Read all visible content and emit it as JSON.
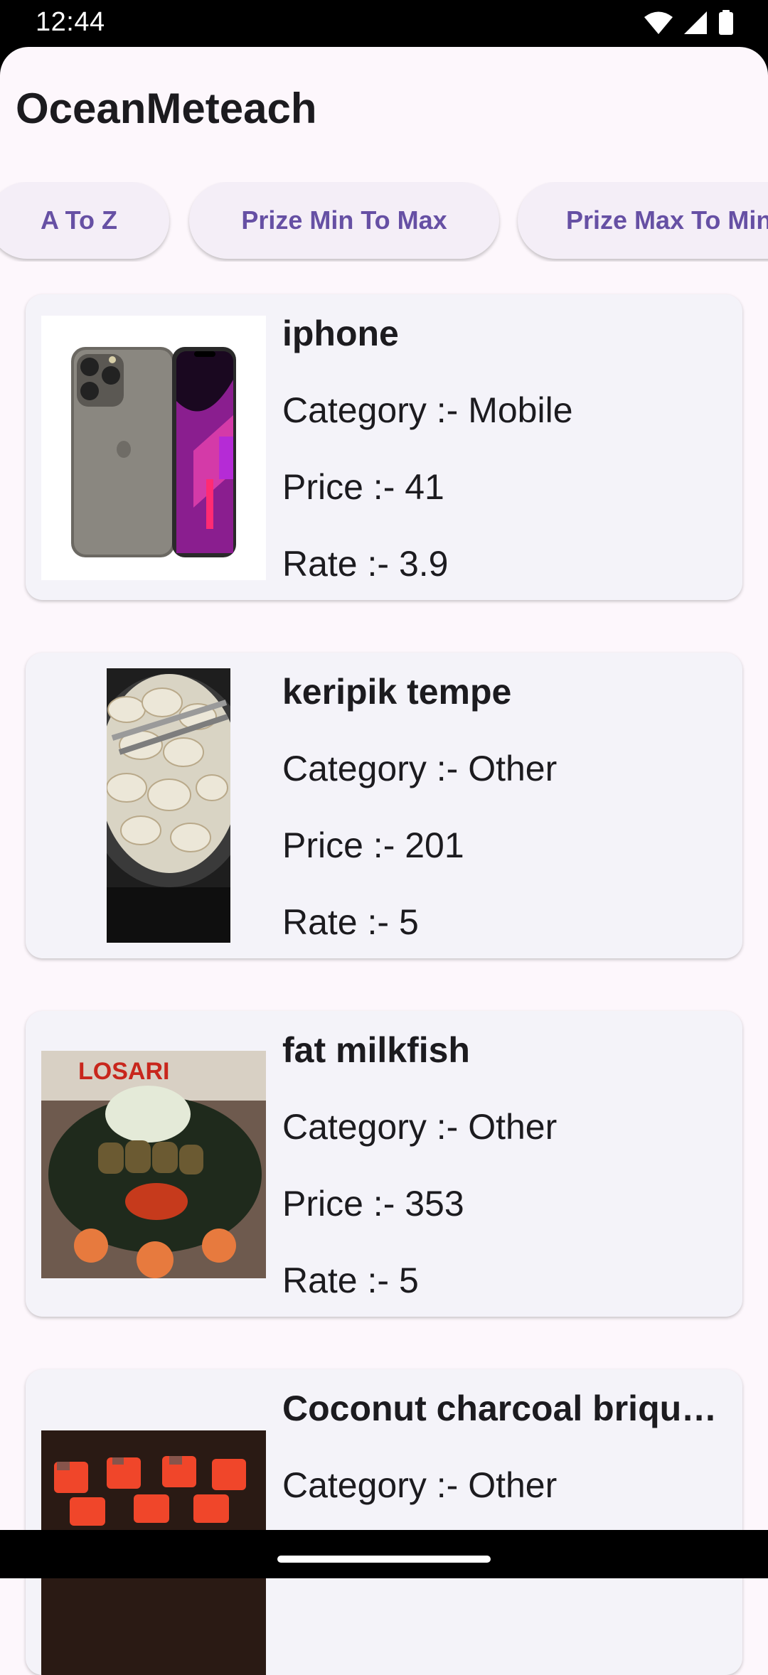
{
  "status_bar": {
    "time": "12:44"
  },
  "app": {
    "title": "OceanMeteach"
  },
  "sort_chips": [
    {
      "label": "A To Z"
    },
    {
      "label": "Prize Min To Max"
    },
    {
      "label": "Prize Max To Min"
    }
  ],
  "products": [
    {
      "name": "iphone",
      "category": "Category :- Mobile",
      "price": "Price :- 41",
      "rate": "Rate :- 3.9"
    },
    {
      "name": "keripik tempe",
      "category": "Category :- Other",
      "price": "Price :- 201",
      "rate": "Rate :- 5"
    },
    {
      "name": "fat milkfish",
      "category": "Category :- Other",
      "price": "Price :- 353",
      "rate": "Rate :- 5",
      "image_text": "LOSARI"
    },
    {
      "name": "Coconut charcoal briquettes",
      "category": "Category :- Other",
      "price": "",
      "rate": ""
    }
  ]
}
